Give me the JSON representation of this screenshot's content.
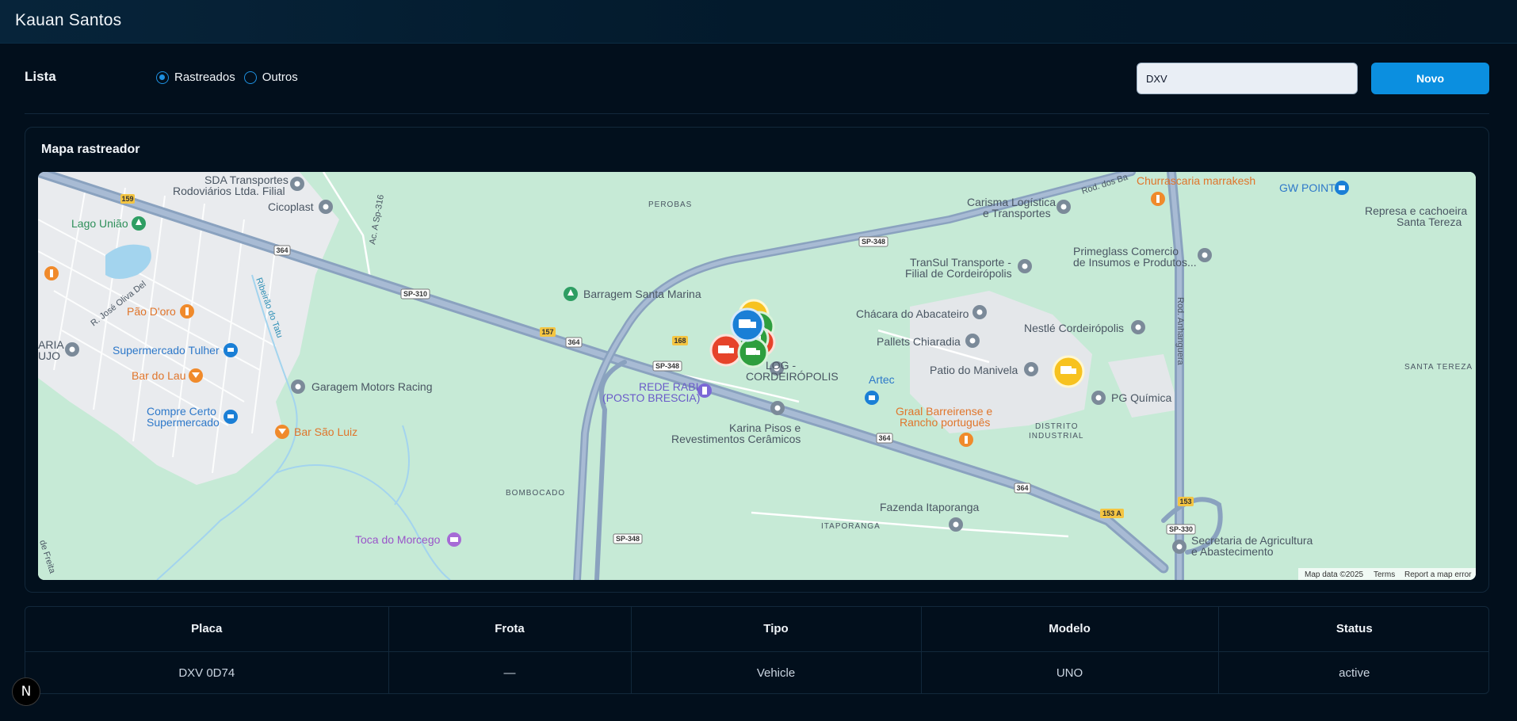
{
  "header": {
    "user_name": "Kauan Santos"
  },
  "toolbar": {
    "list_title": "Lista",
    "radios": [
      {
        "label": "Rastreados",
        "checked": true
      },
      {
        "label": "Outros",
        "checked": false
      }
    ],
    "search_value": "DXV",
    "new_label": "Novo"
  },
  "map": {
    "title": "Mapa rastreador",
    "attribution": {
      "data": "Map data ©2025",
      "terms": "Terms",
      "report": "Report a map error"
    },
    "places": {
      "sda": "SDA Transportes",
      "sda2": "Rodoviários Ltda. Filial",
      "cicoplast": "Cicoplast",
      "lago": "Lago União",
      "perobas": "PEROBAS",
      "carisma": "Carisma Logística",
      "carisma2": "e Transportes",
      "churrascaria": "Churrascaria marrakesh",
      "gwpoint": "GW POINT",
      "represa": "Represa e cachoeira",
      "represa2": "Santa Tereza",
      "transul": "TranSul Transporte -",
      "transul2": "Filial de Cordeirópolis",
      "primeglass": "Primeglass Comercio",
      "primeglass2": "de Insumos e Produtos...",
      "barragem": "Barragem Santa Marina",
      "paodoro": "Pão D'oro",
      "chacara": "Chácara do Abacateiro",
      "nestle": "Nestlé Cordeirópolis",
      "pallets": "Pallets Chiaradia",
      "patio": "Patio do Manivela",
      "santatereza": "SANTA TEREZA",
      "supertulher": "Supermercado Tulher",
      "bardolau": "Bar do Lau",
      "garagem": "Garagem Motors Racing",
      "log": "LOG -",
      "cordeiropolis": "CORDEIRÓPOLIS",
      "rede": "REDE RABI",
      "posto": "(POSTO BRESCIA)",
      "artec": "Artec",
      "pgquimica": "PG Química",
      "compre": "Compre Certo",
      "compre2": "Supermercado",
      "karina": "Karina Pisos e",
      "karina2": "Revestimentos Cerâmicos",
      "graal": "Graal Barreirense e",
      "graal2": "Rancho português",
      "distrito": "DISTRITO",
      "distrito2": "INDUSTRIAL",
      "barsaoluiz": "Bar São Luiz",
      "bombocado": "BOMBOCADO",
      "fazenda": "Fazenda Itaporanga",
      "itaporanga": "ITAPORANGA",
      "toca": "Toca do Morcego",
      "secretaria": "Secretaria de Agricultura",
      "secretaria2": "e Abastecimento",
      "aria": "ARIA",
      "ujo": "UJO",
      "joseoliva": "R. José Oliva Del",
      "ribeirao": "Ribeirão do Tatu",
      "acesso": "Ac. A Sp-316",
      "rodanhanguera": "Rod. Anhanguera",
      "roddos": "Rod. dos Ba",
      "defreitas": "de Freita"
    },
    "shields": [
      "159",
      "364",
      "SP-310",
      "157",
      "364",
      "168",
      "SP-348",
      "SP-348",
      "364",
      "364",
      "153 A",
      "153",
      "SP-330",
      "SP-348"
    ],
    "colors": {
      "yellow": "#f7c21f",
      "blue": "#1a7fd6",
      "green": "#2e9e3e",
      "red": "#e6432a"
    }
  },
  "table": {
    "headers": [
      "Placa",
      "Frota",
      "Tipo",
      "Modelo",
      "Status"
    ],
    "rows": [
      [
        "DXV 0D74",
        "—",
        "Vehicle",
        "UNO",
        "active"
      ]
    ]
  },
  "badge": "N"
}
